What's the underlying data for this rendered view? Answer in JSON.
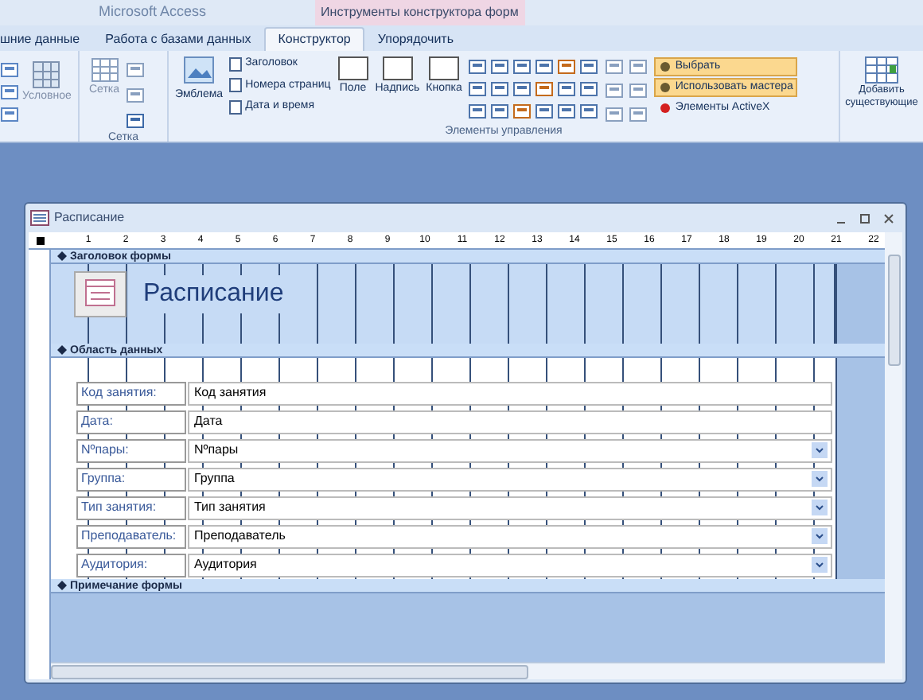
{
  "app": {
    "title": "Microsoft Access",
    "context_title": "Инструменты конструктора форм"
  },
  "tabs": [
    {
      "label": "шние данные",
      "selected": false
    },
    {
      "label": "Работа с базами данных",
      "selected": false
    },
    {
      "label": "Конструктор",
      "selected": true
    },
    {
      "label": "Упорядочить",
      "selected": false
    }
  ],
  "ribbon": {
    "conditional": "Условное",
    "grid_button": "Сетка",
    "grid_group": "Сетка",
    "logo_button": "Эмблема",
    "header_items": [
      "Заголовок",
      "Номера страниц",
      "Дата и время"
    ],
    "controls": [
      "Поле",
      "Надпись",
      "Кнопка"
    ],
    "toggles": [
      {
        "label": "Выбрать",
        "on": true
      },
      {
        "label": "Использовать мастера",
        "on": true
      },
      {
        "label": "Элементы ActiveX",
        "on": false
      }
    ],
    "controls_group": "Элементы управления",
    "add_fields": [
      "Добавить",
      "существующие"
    ]
  },
  "window": {
    "title": "Расписание"
  },
  "ruler": [
    "1",
    "2",
    "3",
    "4",
    "5",
    "6",
    "7",
    "8",
    "9",
    "10",
    "11",
    "12",
    "13",
    "14",
    "15",
    "16",
    "17",
    "18",
    "19",
    "20",
    "21",
    "22"
  ],
  "sections": {
    "header": "Заголовок формы",
    "detail": "Область данных",
    "footer": "Примечание формы"
  },
  "form_title": "Расписание",
  "fields": [
    {
      "label": "Код занятия:",
      "value": "Код занятия",
      "kind": "text"
    },
    {
      "label": "Дата:",
      "value": "Дата",
      "kind": "text"
    },
    {
      "label": "Nºпары:",
      "value": "Nºпары",
      "kind": "combo"
    },
    {
      "label": "Группа:",
      "value": "Группа",
      "kind": "combo"
    },
    {
      "label": "Тип занятия:",
      "value": "Тип занятия",
      "kind": "combo"
    },
    {
      "label": "Преподаватель:",
      "value": "Преподаватель",
      "kind": "combo"
    },
    {
      "label": "Аудитория:",
      "value": "Аудитория",
      "kind": "combo"
    }
  ]
}
